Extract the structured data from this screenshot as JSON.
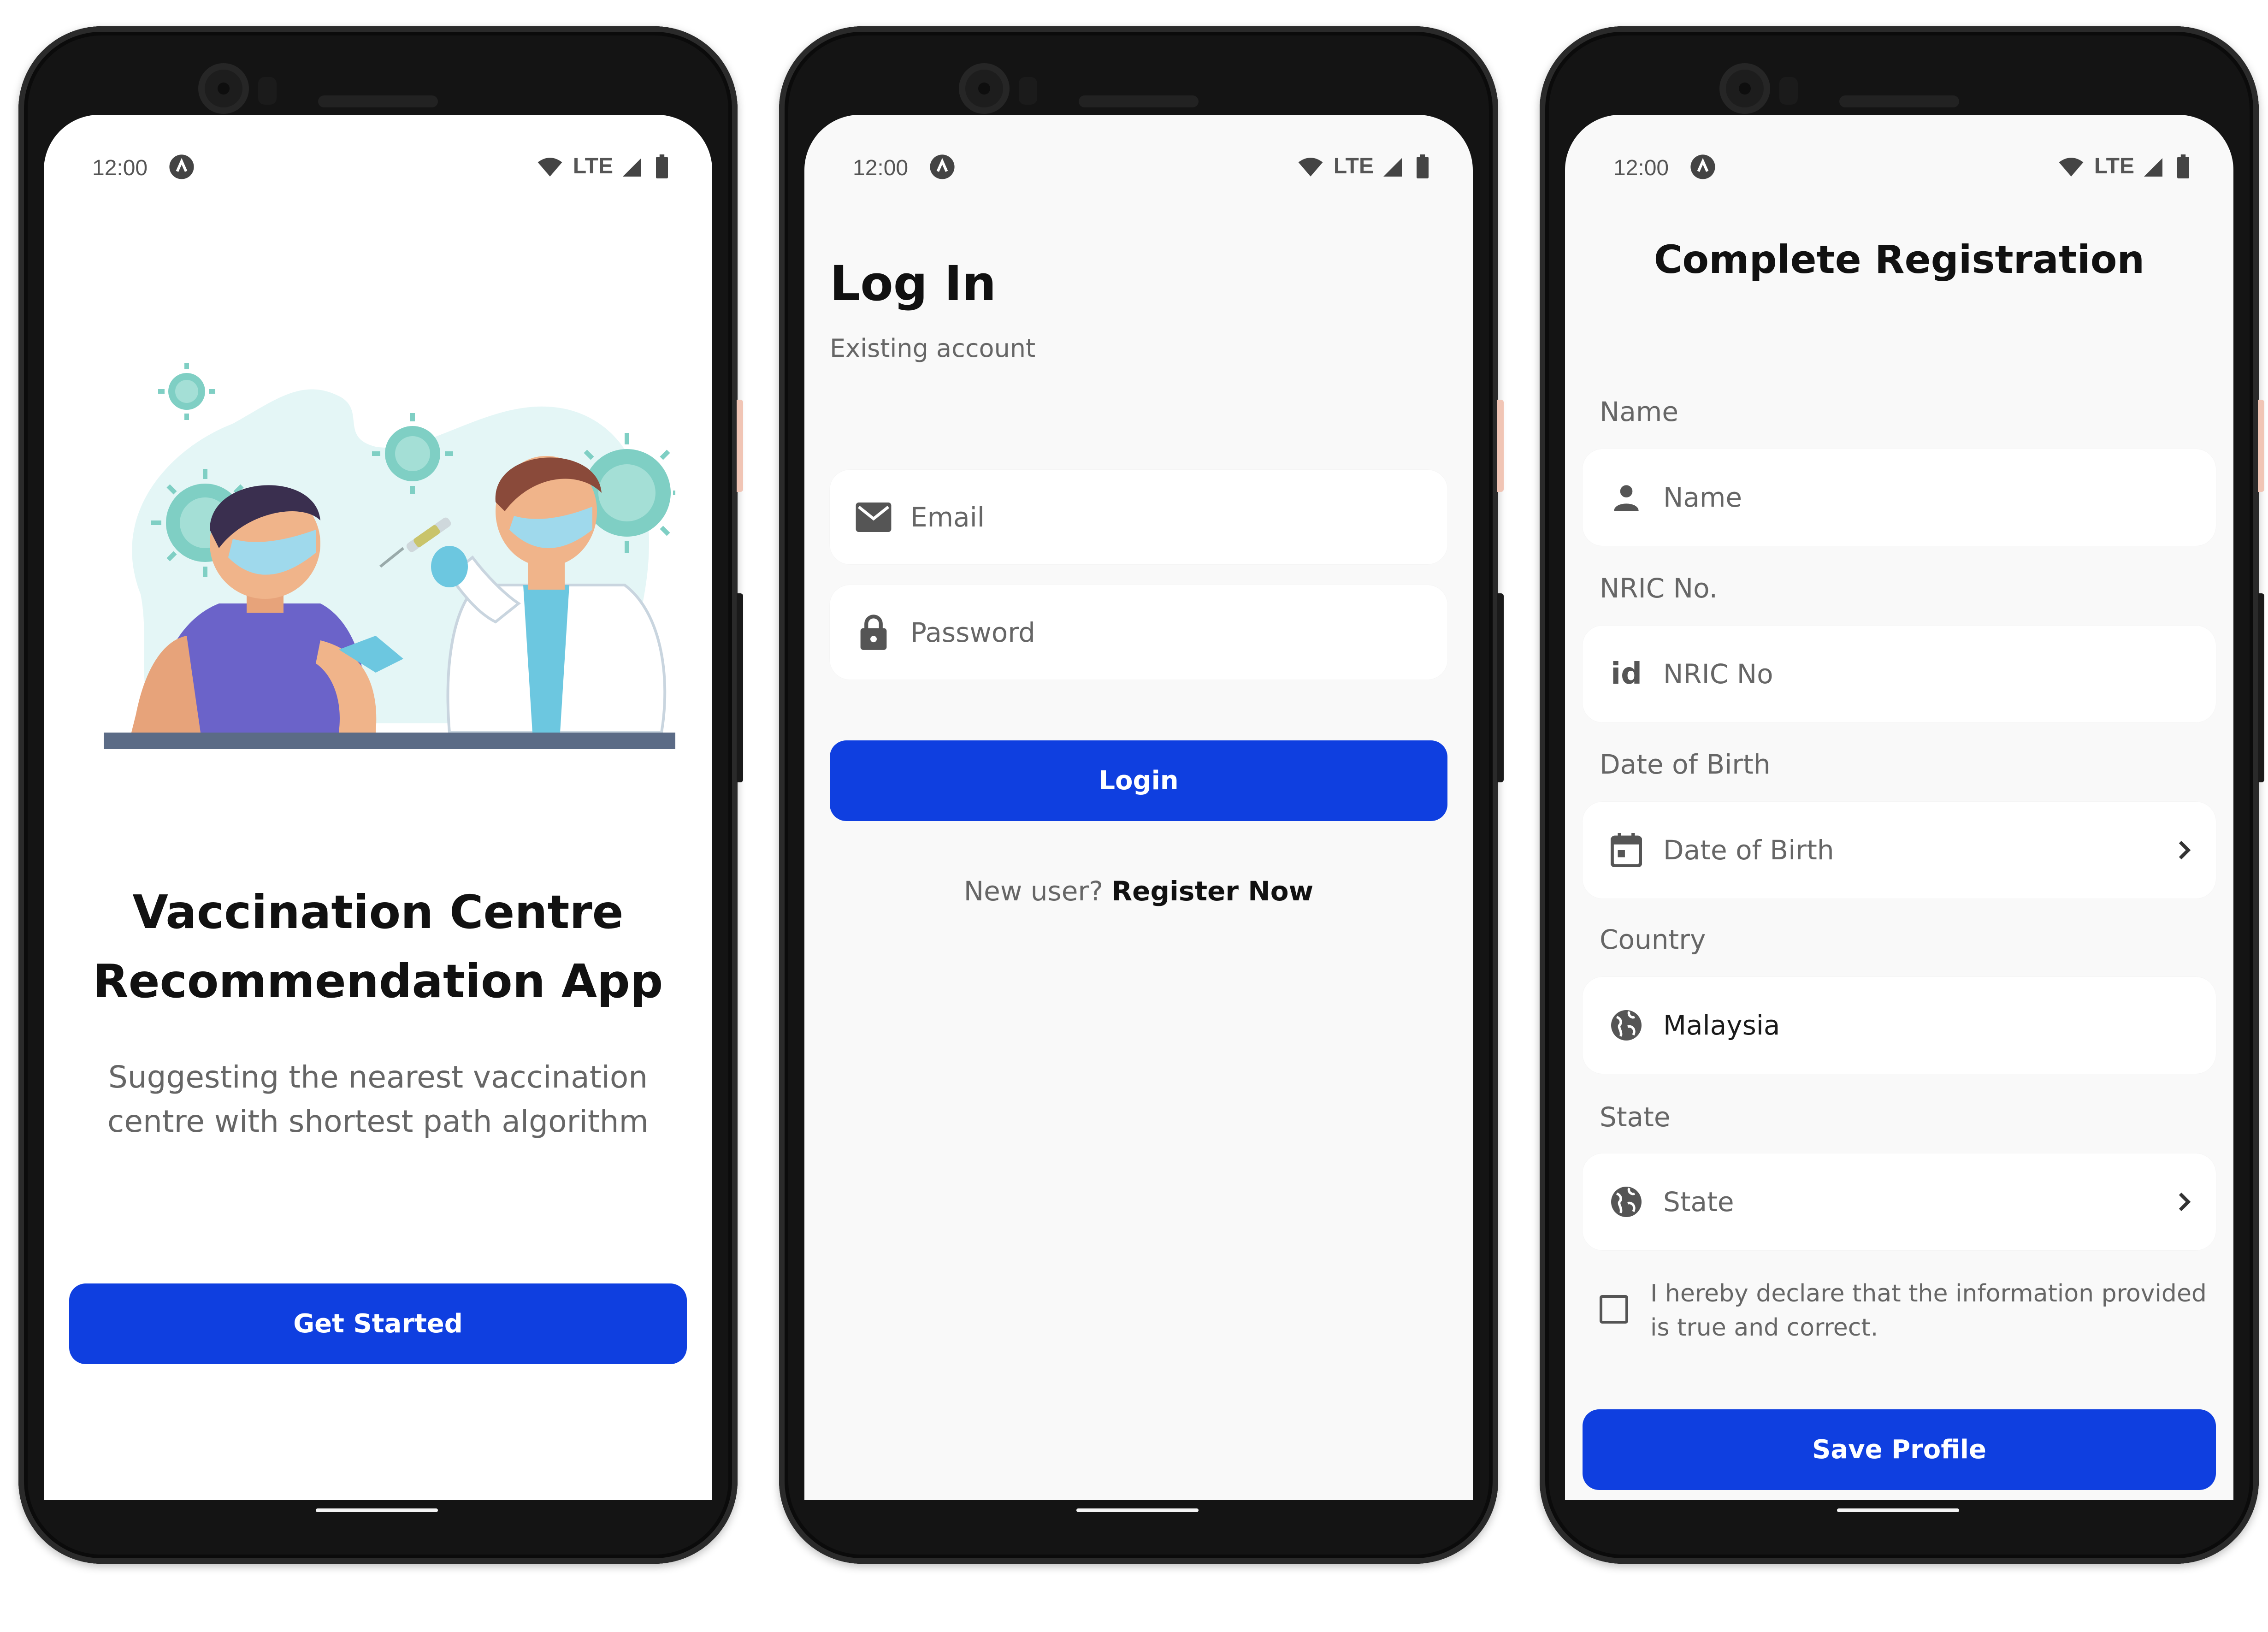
{
  "status_bar": {
    "time": "12:00",
    "network": "LTE"
  },
  "welcome": {
    "title_line1": "Vaccination Centre",
    "title_line2": "Recommendation App",
    "subtitle_line1": "Suggesting the nearest vaccination",
    "subtitle_line2": "centre with shortest path algorithm",
    "button": "Get Started"
  },
  "login": {
    "title": "Log In",
    "subtitle": "Existing account",
    "email_placeholder": "Email",
    "password_placeholder": "Password",
    "button": "Login",
    "new_user_text": "New user?",
    "register_link": "Register Now"
  },
  "registration": {
    "title": "Complete Registration",
    "name_label": "Name",
    "name_placeholder": "Name",
    "nric_label": "NRIC No.",
    "nric_placeholder": "NRIC No",
    "nric_icon_text": "id",
    "dob_label": "Date of Birth",
    "dob_placeholder": "Date of Birth",
    "country_label": "Country",
    "country_value": "Malaysia",
    "state_label": "State",
    "state_placeholder": "State",
    "declaration_line1": "I hereby declare that the information provided",
    "declaration_line2": "is true and correct.",
    "declaration_checked": false,
    "button": "Save Profile"
  },
  "colors": {
    "primary": "#0f3fe0",
    "screen_bg": "#f9f9f9",
    "field_bg": "#ffffff",
    "text_grey": "#666666"
  }
}
